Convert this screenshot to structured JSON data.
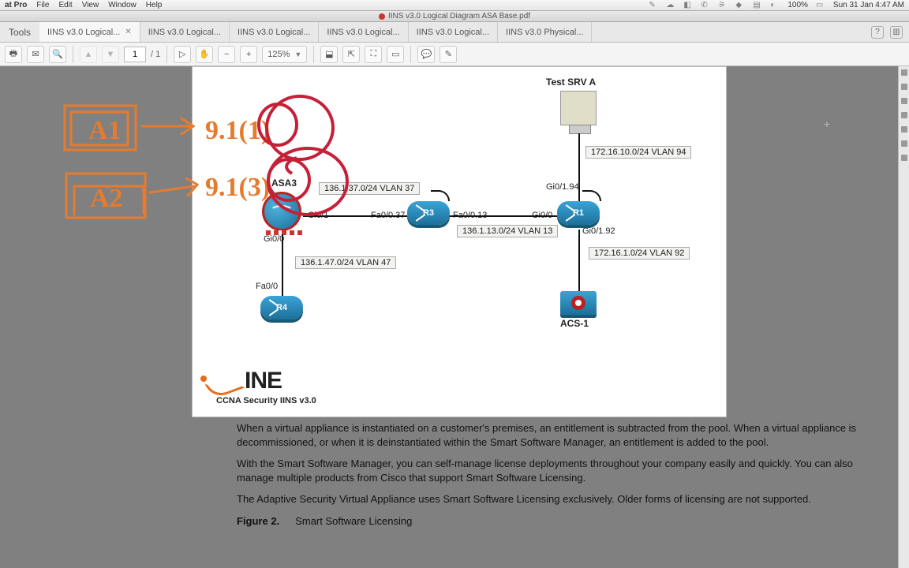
{
  "menubar": {
    "app": "at Pro",
    "items": [
      "File",
      "Edit",
      "View",
      "Window",
      "Help"
    ],
    "battery": "100%",
    "clock": "Sun 31 Jan  4:47 AM"
  },
  "titlebar": {
    "filename": "IINS v3.0 Logical Diagram ASA Base.pdf"
  },
  "tabs": {
    "tools": "Tools",
    "items": [
      {
        "label": "IINS v3.0 Logical...",
        "active": true,
        "closeable": true
      },
      {
        "label": "IINS v3.0 Logical..."
      },
      {
        "label": "IINS v3.0 Logical..."
      },
      {
        "label": "IINS v3.0 Logical..."
      },
      {
        "label": "IINS v3.0 Logical..."
      },
      {
        "label": "IINS v3.0 Physical..."
      }
    ]
  },
  "toolbar": {
    "page_current": "1",
    "page_total": "/ 1",
    "zoom": "125%"
  },
  "diagram": {
    "title": "Test SRV A",
    "asa": "ASA3",
    "r3": "R3",
    "r1": "R1",
    "r4": "R4",
    "acs": "ACS-1",
    "vlan37": "136.1.37.0/24 VLAN 37",
    "vlan13": "136.1.13.0/24 VLAN 13",
    "vlan47": "136.1.47.0/24 VLAN 47",
    "vlan94": "172.16.10.0/24 VLAN 94",
    "vlan92": "172.16.1.0/24 VLAN 92",
    "if": {
      "gi01": "Gi0/1",
      "gi00a": "Gi0/0",
      "fa000": "Fa0/0",
      "fa0037": "Fa0/0.37",
      "fa0013": "Fa0/0.13",
      "gi00b": "Gi0/0",
      "gi0194": "Gi0/1.94",
      "gi0192": "Gi0/1.92"
    },
    "logo_sub": "CCNA Security IINS v3.0",
    "logo_text": "INE"
  },
  "text": {
    "p1": "When a virtual appliance is instantiated on a customer's premises, an entitlement is subtracted from the pool. When a virtual appliance is decommissioned, or when it is deinstantiated within the Smart Software Manager, an entitlement is added to the pool.",
    "p2": "With the Smart Software Manager, you can self-manage license deployments throughout your company easily and quickly. You can also manage multiple products from Cisco that support Smart Software Licensing.",
    "p3": "The Adaptive Security Virtual Appliance uses Smart Software Licensing exclusively. Older forms of licensing are not supported.",
    "fig_num": "Figure 2.",
    "fig_cap": "Smart Software Licensing"
  },
  "annot": {
    "a1": "A1",
    "a2": "A2",
    "n1": "9.1(1)",
    "n3": "9.1(3)"
  }
}
